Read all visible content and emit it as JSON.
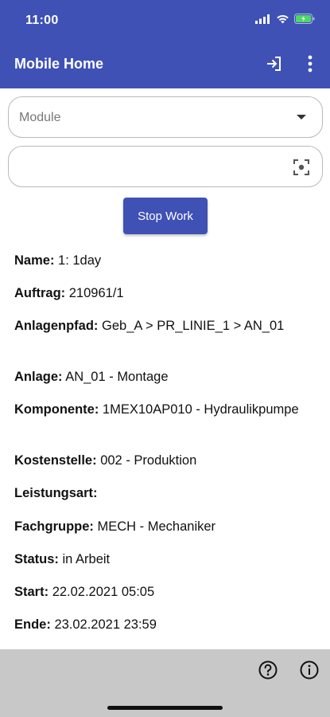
{
  "status_bar": {
    "time": "11:00"
  },
  "app_bar": {
    "title": "Mobile Home",
    "icons": [
      "logout-icon",
      "more-vert-icon"
    ]
  },
  "module_select": {
    "placeholder": "Module",
    "value": ""
  },
  "scan_field": {
    "value": ""
  },
  "stop_button": {
    "label": "Stop Work"
  },
  "details": [
    {
      "label": "Name:",
      "value": "1: 1day"
    },
    {
      "label": "Auftrag:",
      "value": "210961/1"
    },
    {
      "label": "Anlagenpfad:",
      "value": "Geb_A > PR_LINIE_1 > AN_01"
    },
    {
      "label": "Anlage:",
      "value": "AN_01 - Montage"
    },
    {
      "label": "Komponente:",
      "value": "1MEX10AP010 - Hydraulikpumpe"
    },
    {
      "label": "Kostenstelle:",
      "value": "002 - Produktion"
    },
    {
      "label": "Leistungsart:",
      "value": ""
    },
    {
      "label": "Fachgruppe:",
      "value": "MECH - Mechaniker"
    },
    {
      "label": "Status:",
      "value": "in Arbeit"
    },
    {
      "label": "Start:",
      "value": "22.02.2021 05:05"
    },
    {
      "label": "Ende:",
      "value": "23.02.2021 23:59"
    }
  ],
  "bottom_bar": {
    "icons": [
      "help-icon",
      "info-icon"
    ]
  },
  "colors": {
    "primary": "#3f51b5",
    "bottom_bar": "#c8c8c8",
    "battery": "#4cd964"
  }
}
